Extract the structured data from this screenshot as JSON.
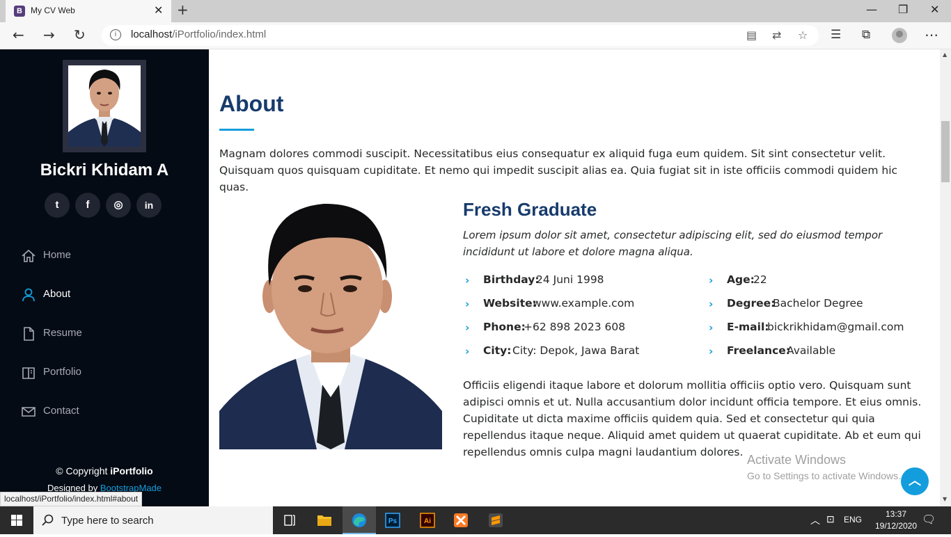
{
  "browser": {
    "tab_title": "My CV Web",
    "tab_favicon_letter": "B",
    "url_host": "localhost",
    "url_path": "/iPortfolio/index.html",
    "status_url": "localhost/iPortfolio/index.html#about"
  },
  "sidebar": {
    "name": "Bickri Khidam A",
    "social": [
      {
        "icon": "twitter-icon",
        "glyph": "t"
      },
      {
        "icon": "facebook-icon",
        "glyph": "f"
      },
      {
        "icon": "instagram-icon",
        "glyph": "◎"
      },
      {
        "icon": "linkedin-icon",
        "glyph": "in"
      }
    ],
    "nav": [
      {
        "label": "Home",
        "icon": "home-icon",
        "active": false
      },
      {
        "label": "About",
        "icon": "person-icon",
        "active": true
      },
      {
        "label": "Resume",
        "icon": "file-icon",
        "active": false
      },
      {
        "label": "Portfolio",
        "icon": "book-icon",
        "active": false
      },
      {
        "label": "Contact",
        "icon": "envelope-icon",
        "active": false
      }
    ],
    "copyright_prefix": "© Copyright",
    "copyright_brand": "iPortfolio",
    "designed_prefix": "Designed by",
    "designed_link": "BootstrapMade"
  },
  "about": {
    "title": "About",
    "intro": "Magnam dolores commodi suscipit. Necessitatibus eius consequatur ex aliquid fuga eum quidem. Sit sint consectetur velit. Quisquam quos quisquam cupiditate. Et nemo qui impedit suscipit alias ea. Quia fugiat sit in iste officiis commodi quidem hic quas.",
    "role": "Fresh Graduate",
    "role_desc": "Lorem ipsum dolor sit amet, consectetur adipiscing elit, sed do eiusmod tempor incididunt ut labore et dolore magna aliqua.",
    "info_left": [
      {
        "key": "Birthday:",
        "value": "24 Juni 1998"
      },
      {
        "key": "Website:",
        "value": "www.example.com"
      },
      {
        "key": "Phone:",
        "value": "+62 898 2023 608"
      },
      {
        "key": "City:",
        "value": "City: Depok, Jawa Barat"
      }
    ],
    "info_right": [
      {
        "key": "Age:",
        "value": "22"
      },
      {
        "key": "Degree:",
        "value": "Bachelor Degree"
      },
      {
        "key": "E-mail:",
        "value": "bickrikhidam@gmail.com"
      },
      {
        "key": "Freelance:",
        "value": "Available"
      }
    ],
    "body": "Officiis eligendi itaque labore et dolorum mollitia officiis optio vero. Quisquam sunt adipisci omnis et ut. Nulla accusantium dolor incidunt officia tempore. Et eius omnis. Cupiditate ut dicta maxime officiis quidem quia. Sed et consectetur qui quia repellendus itaque neque. Aliquid amet quidem ut quaerat cupiditate. Ab et eum qui repellendus omnis culpa magni laudantium dolores."
  },
  "watermark": {
    "title": "Activate Windows",
    "subtitle": "Go to Settings to activate Windows."
  },
  "taskbar": {
    "search_placeholder": "Type here to search",
    "language": "ENG",
    "time": "13:37",
    "date": "19/12/2020"
  },
  "colors": {
    "accent": "#149ddd",
    "heading": "#173b6c",
    "sidebar_bg": "#040b14"
  }
}
